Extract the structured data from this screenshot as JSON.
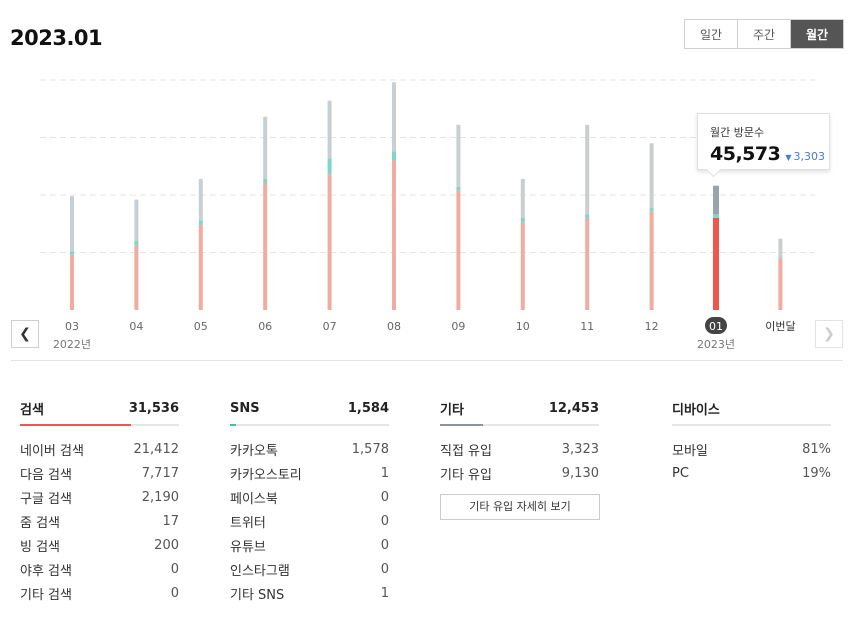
{
  "period_title": "2023.01",
  "toggle": {
    "daily": "일간",
    "weekly": "주간",
    "monthly": "월간",
    "active": "monthly"
  },
  "tooltip": {
    "label": "월간 방문수",
    "value": "45,573",
    "delta": "3,303"
  },
  "colors": {
    "search": "#f2aba1",
    "search_active": "#f0564a",
    "sns": "#7fd6cc",
    "other": "#c9ced3",
    "other_active": "#9aa4ae",
    "sns_bar": "#36c4b4",
    "search_bar": "#f0564a",
    "other_bar": "#8a949c"
  },
  "chart_data": {
    "type": "bar",
    "stacked": true,
    "categories": [
      "03",
      "04",
      "05",
      "06",
      "07",
      "08",
      "09",
      "10",
      "11",
      "12",
      "01",
      "이번달"
    ],
    "year_labels": [
      {
        "category": "03",
        "label": "2022년"
      },
      {
        "category": "01",
        "label": "2023년"
      }
    ],
    "selected": "01",
    "series": [
      {
        "key": "search",
        "values": [
          24000,
          28000,
          37000,
          55000,
          59000,
          65000,
          52000,
          38000,
          40000,
          43000,
          40000,
          22500
        ]
      },
      {
        "key": "sns",
        "values": [
          1500,
          2000,
          2000,
          2000,
          7000,
          4000,
          1500,
          2000,
          1500,
          1500,
          1584,
          500
        ]
      },
      {
        "key": "other",
        "values": [
          24000,
          18000,
          18000,
          27000,
          25000,
          30000,
          27000,
          17000,
          39000,
          28000,
          12453,
          8000
        ]
      }
    ],
    "ylim": [
      0,
      100000
    ],
    "grid": true
  },
  "panels": {
    "search": {
      "title": "검색",
      "total": "31,536",
      "share": 0.7,
      "rows": [
        {
          "label": "네이버 검색",
          "value": "21,412"
        },
        {
          "label": "다음 검색",
          "value": "7,717"
        },
        {
          "label": "구글 검색",
          "value": "2,190"
        },
        {
          "label": "줌 검색",
          "value": "17"
        },
        {
          "label": "빙 검색",
          "value": "200"
        },
        {
          "label": "야후 검색",
          "value": "0"
        },
        {
          "label": "기타 검색",
          "value": "0"
        }
      ]
    },
    "sns": {
      "title": "SNS",
      "total": "1,584",
      "share": 0.04,
      "rows": [
        {
          "label": "카카오톡",
          "value": "1,578"
        },
        {
          "label": "카카오스토리",
          "value": "1"
        },
        {
          "label": "페이스북",
          "value": "0"
        },
        {
          "label": "트위터",
          "value": "0"
        },
        {
          "label": "유튜브",
          "value": "0"
        },
        {
          "label": "인스타그램",
          "value": "0"
        },
        {
          "label": "기타 SNS",
          "value": "1"
        }
      ]
    },
    "other": {
      "title": "기타",
      "total": "12,453",
      "share": 0.27,
      "rows": [
        {
          "label": "직접 유입",
          "value": "3,323"
        },
        {
          "label": "기타 유입",
          "value": "9,130"
        }
      ],
      "detail_button": "기타 유입 자세히 보기"
    },
    "device": {
      "title": "디바이스",
      "rows": [
        {
          "label": "모바일",
          "value": "81%"
        },
        {
          "label": "PC",
          "value": "19%"
        }
      ]
    }
  }
}
